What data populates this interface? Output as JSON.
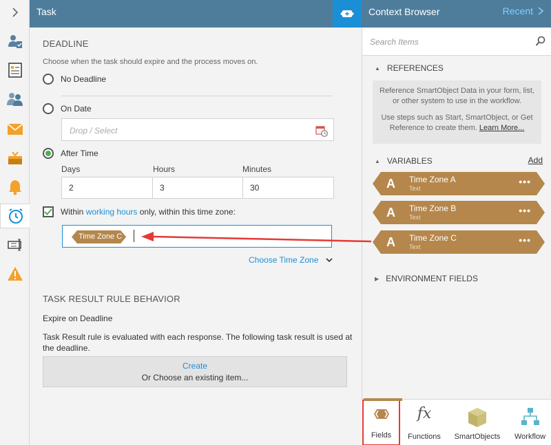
{
  "rail": {
    "items": [
      {
        "icon": "chevron-right-icon"
      },
      {
        "icon": "user-task-icon"
      },
      {
        "icon": "form-icon"
      },
      {
        "icon": "users-icon"
      },
      {
        "icon": "envelope-icon"
      },
      {
        "icon": "inbox-icon"
      },
      {
        "icon": "bell-icon"
      },
      {
        "icon": "alarm-clock-icon",
        "active": true
      },
      {
        "icon": "text-cursor-icon"
      },
      {
        "icon": "warning-icon"
      }
    ]
  },
  "task": {
    "title": "Task",
    "deadline": {
      "heading": "DEADLINE",
      "description": "Choose when the task should expire and the process moves on.",
      "options": {
        "no_deadline": "No Deadline",
        "on_date": "On Date",
        "after_time": "After Time"
      },
      "selected": "after_time",
      "date_placeholder": "Drop / Select",
      "columns": {
        "days": "Days",
        "hours": "Hours",
        "minutes": "Minutes"
      },
      "values": {
        "days": "2",
        "hours": "3",
        "minutes": "30"
      },
      "working_hours": {
        "checked": true,
        "prefix": "Within ",
        "link": "working hours",
        "suffix": " only, within this time zone:"
      },
      "time_zone_token": "Time Zone C",
      "choose_time_zone": "Choose Time Zone"
    },
    "result_rule": {
      "heading": "TASK RESULT RULE BEHAVIOR",
      "expire_label": "Expire on Deadline",
      "description": "Task Result rule is evaluated with each response. The following task result is used at the deadline.",
      "create": "Create",
      "choose_existing": "Or Choose an existing item..."
    }
  },
  "context_browser": {
    "title": "Context Browser",
    "recent": "Recent",
    "search_placeholder": "Search Items",
    "references": {
      "heading": "REFERENCES",
      "info_1": "Reference SmartObject Data in your form, list, or other system to use in the workflow.",
      "info_2_prefix": "Use steps such as Start, SmartObject, or Get Reference to create them. ",
      "info_2_link": "Learn More..."
    },
    "variables": {
      "heading": "VARIABLES",
      "add": "Add",
      "items": [
        {
          "name": "Time Zone A",
          "type": "Text"
        },
        {
          "name": "Time Zone B",
          "type": "Text"
        },
        {
          "name": "Time Zone C",
          "type": "Text"
        }
      ]
    },
    "environment_fields": {
      "heading": "ENVIRONMENT FIELDS"
    }
  },
  "tabs": [
    {
      "label": "Fields",
      "icon": "fields-icon",
      "active": true
    },
    {
      "label": "Functions",
      "icon": "fx-icon"
    },
    {
      "label": "SmartObjects",
      "icon": "cube-icon"
    },
    {
      "label": "Workflow",
      "icon": "workflow-icon"
    }
  ],
  "colors": {
    "header": "#4e7d9c",
    "accent_blue": "#1b8fd6",
    "token_brown": "#b5874c",
    "arrow_red": "#e53935",
    "radio_green": "#4caf50",
    "rail_orange": "#f2a12b"
  }
}
